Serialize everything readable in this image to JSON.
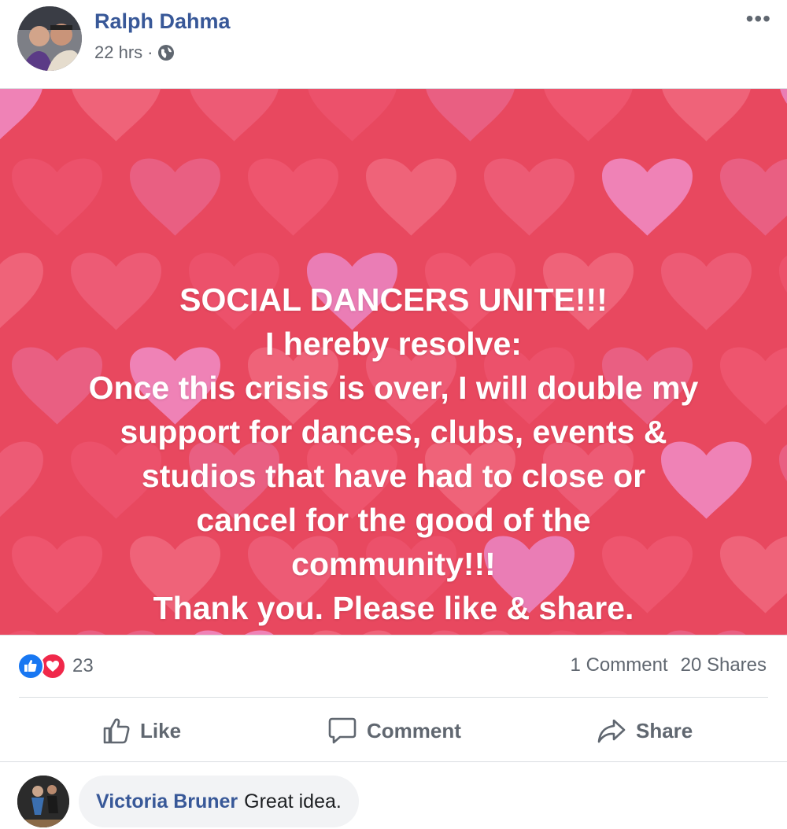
{
  "post": {
    "author": "Ralph Dahma",
    "time": "22 hrs",
    "time_separator": "·",
    "privacy_icon": "globe-icon",
    "more_icon": "more-options-icon",
    "banner": {
      "background": "#e8485f",
      "lines": [
        "SOCIAL DANCERS UNITE!!!",
        "I hereby resolve:",
        "Once this crisis is over, I will double my",
        "support for dances, clubs, events &",
        "studios that have had to close or",
        "cancel for the good of the",
        "community!!!",
        "Thank you. Please like & share."
      ]
    },
    "reactions": {
      "types": [
        "like",
        "love"
      ],
      "count": "23"
    },
    "stats": {
      "comments": "1 Comment",
      "shares": "20 Shares"
    },
    "actions": {
      "like": "Like",
      "comment": "Comment",
      "share": "Share"
    }
  },
  "comments": [
    {
      "author": "Victoria Bruner",
      "text": "Great idea."
    }
  ],
  "colors": {
    "link_blue": "#385898",
    "like_blue": "#1877f2",
    "love_red": "#f0284a",
    "muted_text": "#606770"
  }
}
